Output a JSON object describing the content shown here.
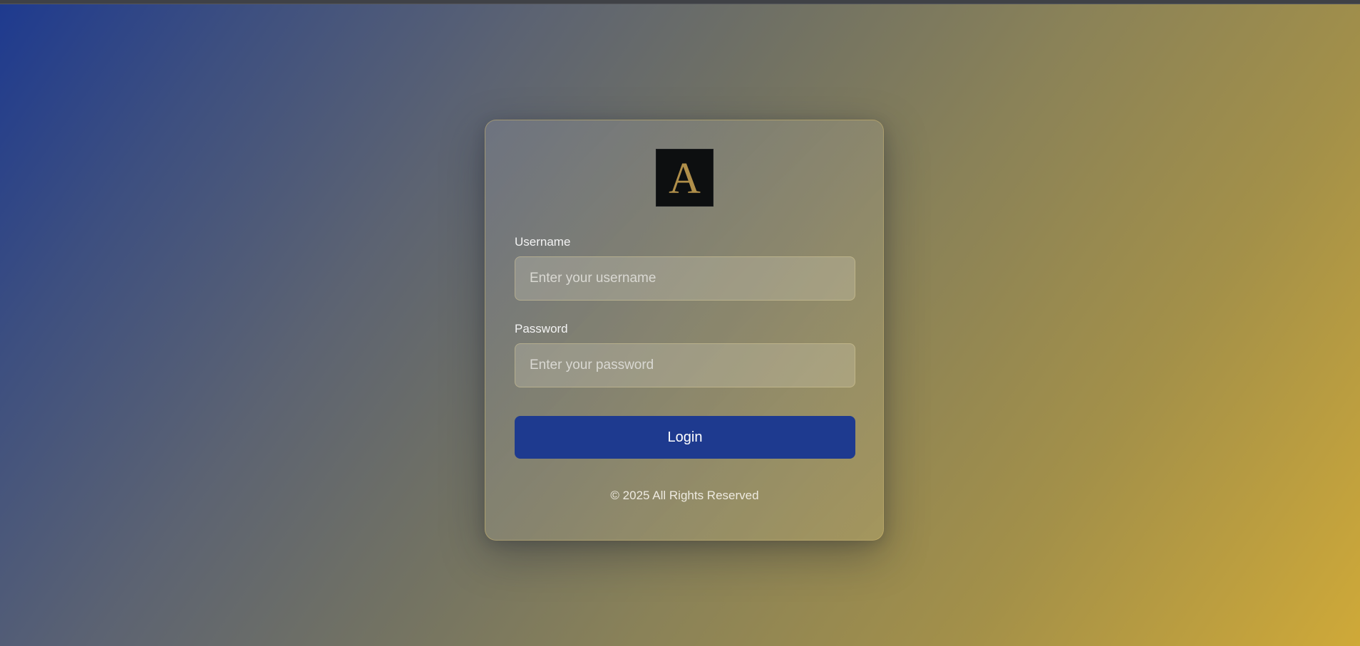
{
  "logo": {
    "letter": "A"
  },
  "form": {
    "username_label": "Username",
    "username_placeholder": "Enter your username",
    "username_value": "",
    "password_label": "Password",
    "password_placeholder": "Enter your password",
    "password_value": "",
    "login_label": "Login"
  },
  "footer": {
    "text": "© 2025 All Rights Reserved"
  },
  "colors": {
    "accent": "#1e3a8f",
    "logo_gold": "#b08f4a",
    "logo_bg": "#0d0f10",
    "gradient_start": "#1e3a8f",
    "gradient_end": "#cfa938"
  }
}
